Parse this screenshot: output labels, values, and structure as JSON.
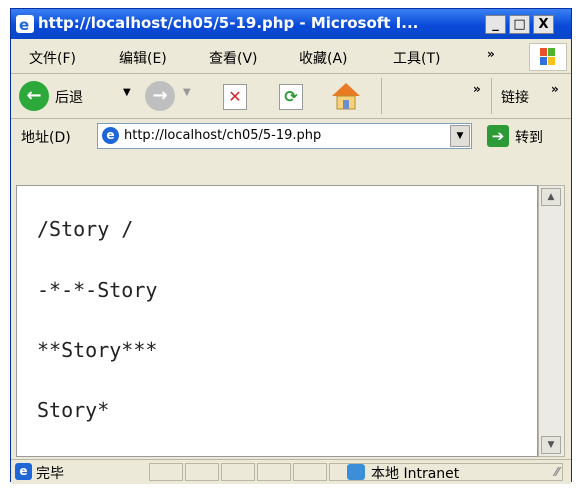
{
  "window": {
    "title": "http://localhost/ch05/5-19.php - Microsoft I...",
    "minimize_label": "_",
    "maximize_label": "□",
    "close_label": "X",
    "icon": "ie-logo-icon"
  },
  "menubar": {
    "items": [
      {
        "label": "文件(F)"
      },
      {
        "label": "编辑(E)"
      },
      {
        "label": "查看(V)"
      },
      {
        "label": "收藏(A)"
      },
      {
        "label": "工具(T)"
      }
    ],
    "overflow_label": "»",
    "flag_icon": "windows-flag-icon"
  },
  "toolbar": {
    "back_label": "后退",
    "links_label": "链接",
    "overflow_label": "»",
    "icons": [
      "back-arrow-icon",
      "forward-arrow-icon",
      "stop-icon",
      "refresh-icon",
      "home-icon"
    ]
  },
  "address_bar": {
    "label": "地址(D)",
    "url": "http://localhost/ch05/5-19.php",
    "go_label": "转到"
  },
  "page": {
    "lines": [
      "/Story /",
      "-*-*-Story",
      "**Story***",
      "Story*"
    ]
  },
  "status": {
    "text": "完毕",
    "zone": "本地 Intranet"
  },
  "colors": {
    "titlebar": "#0a4ad8",
    "chrome": "#ece9d8",
    "content_bg": "#ffffff"
  }
}
